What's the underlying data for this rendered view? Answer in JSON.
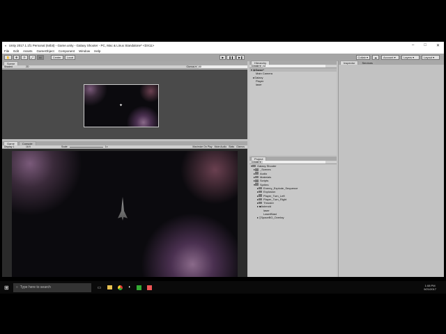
{
  "window": {
    "title": "Unity 2017.1.1f1 Personal (64bit) - Game.unity - Galaxy Shooter - PC, Mac & Linux Standalone* <DX11>",
    "minimize": "–",
    "maximize": "□",
    "close": "✕"
  },
  "menu": [
    "File",
    "Edit",
    "Assets",
    "GameObject",
    "Component",
    "Window",
    "Help"
  ],
  "toolbar": {
    "tools": [
      "✋",
      "✥",
      "⟳",
      "⤢",
      "▭"
    ],
    "pivot": "Center",
    "space": "Local",
    "play": "▶",
    "pause": "❚❚",
    "step": "▶❚",
    "collab": "Collab ▾",
    "account": "Account ▾",
    "layers": "Layers ▾",
    "layout": "Layout ▾"
  },
  "scene": {
    "tab": "Scene",
    "shading": "Shaded",
    "mode": "2D",
    "gizmos": "Gizmos ▾",
    "search": "All"
  },
  "game": {
    "tabs": [
      "Game",
      "Console"
    ],
    "display": "Display 1",
    "aspect": "16:9",
    "scale_label": "Scale",
    "scale_value": "1x",
    "buttons": [
      "Maximize On Play",
      "Mute Audio",
      "Stats",
      "Gizmos"
    ]
  },
  "hierarchy": {
    "tab": "Hierarchy",
    "create": "Create ▾",
    "search": "All",
    "scene": "Game*",
    "items": [
      "Main Camera",
      "Galaxy",
      "Player",
      "laser"
    ]
  },
  "project": {
    "tab": "Project",
    "create": "Create ▾",
    "root": "Galaxy Shooter",
    "folders": [
      "_Scenes",
      "Audio",
      "Materials",
      "Scripts",
      "Sprites"
    ],
    "sprites": [
      "Enemy_Explode_Sequence",
      "Explosion",
      "Player_Turn_Left",
      "Player_Turn_Right",
      "Thruster",
      "Asteroid",
      "laser",
      "LaserBlast",
      "SpaceBG_Overlay"
    ]
  },
  "inspector": {
    "tabs": [
      "Inspector",
      "Services"
    ]
  },
  "taskbar": {
    "search_placeholder": "Type here to search",
    "time": "1:08 PM",
    "date": "9/21/2017"
  }
}
